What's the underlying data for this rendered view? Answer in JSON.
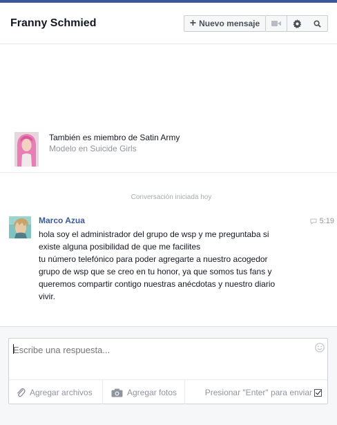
{
  "header": {
    "title": "Franny Schmied",
    "new_message_label": "Nuevo mensaje",
    "icons": [
      "plus-icon",
      "video-icon",
      "gear-icon",
      "search-icon"
    ]
  },
  "profile": {
    "line1": "También es miembro de Satin Army",
    "line2": "Modelo en Suicide Girls"
  },
  "conversation": {
    "start_label": "Conversación iniciada hoy"
  },
  "message": {
    "sender": "Marco Azua",
    "time": "5:19",
    "lines": [
      "hola soy el administrador del grupo de wsp y me preguntaba si",
      "existe alguna posibilidad de que me facilites",
      "tu número telefónico para poder agregarte a nuestro acogedor",
      "grupo de wsp que se creo en tu honor, ya que somos tus fans y",
      "queremos compartir contigo nuestras anécdotas y nuestro diario",
      "vivir."
    ]
  },
  "composer": {
    "placeholder": "Escribe una respuesta...",
    "add_files_label": "Agregar archivos",
    "add_photos_label": "Agregar fotos",
    "enter_to_send_label": "Presionar \"Enter\" para enviar",
    "enter_to_send_checked": true
  },
  "colors": {
    "accent": "#3b5998",
    "text": "#141823",
    "muted": "#90949c"
  }
}
